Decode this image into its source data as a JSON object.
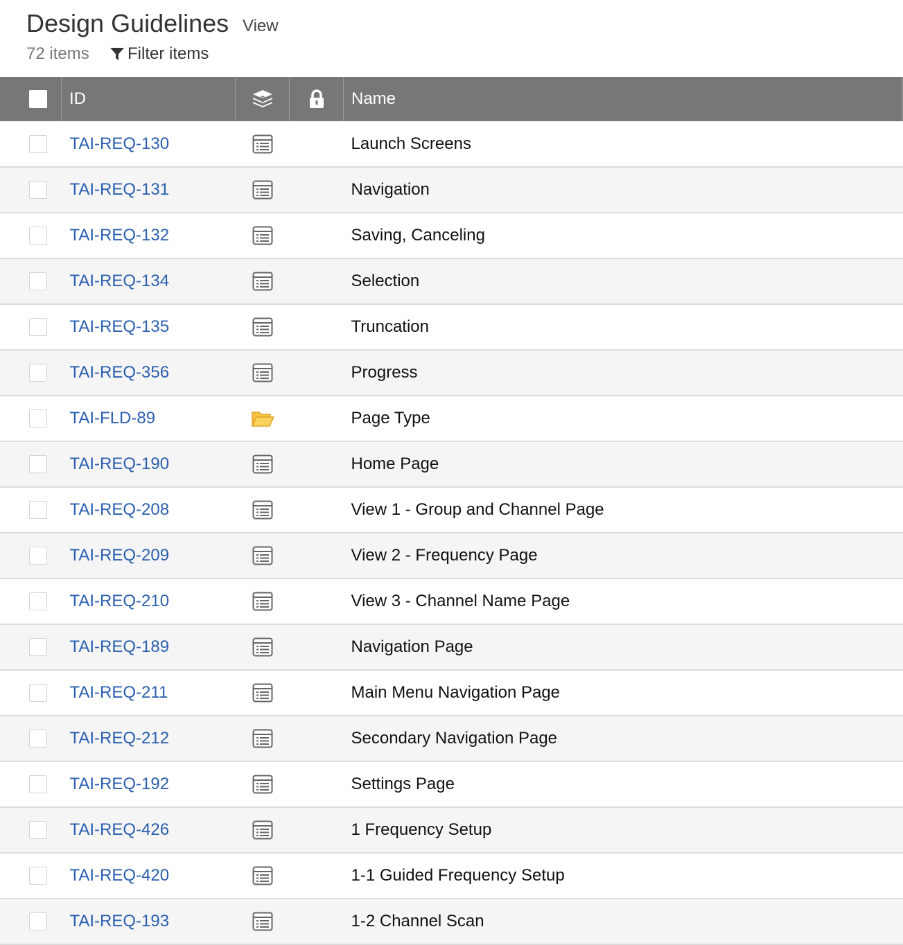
{
  "header": {
    "title": "Design Guidelines",
    "view_label": "View",
    "item_count": "72 items",
    "filter_label": "Filter items"
  },
  "table": {
    "columns": {
      "id": "ID",
      "type_icon": "stack-icon",
      "lock_icon": "lock-icon",
      "name": "Name"
    },
    "rows": [
      {
        "id": "TAI-REQ-130",
        "icon": "requirement-icon",
        "name": "Launch Screens"
      },
      {
        "id": "TAI-REQ-131",
        "icon": "requirement-icon",
        "name": "Navigation"
      },
      {
        "id": "TAI-REQ-132",
        "icon": "requirement-icon",
        "name": "Saving, Canceling"
      },
      {
        "id": "TAI-REQ-134",
        "icon": "requirement-icon",
        "name": "Selection"
      },
      {
        "id": "TAI-REQ-135",
        "icon": "requirement-icon",
        "name": "Truncation"
      },
      {
        "id": "TAI-REQ-356",
        "icon": "requirement-icon",
        "name": "Progress"
      },
      {
        "id": "TAI-FLD-89",
        "icon": "folder-icon",
        "name": "Page Type"
      },
      {
        "id": "TAI-REQ-190",
        "icon": "requirement-icon",
        "name": "Home Page"
      },
      {
        "id": "TAI-REQ-208",
        "icon": "requirement-icon",
        "name": "View 1 - Group and Channel Page"
      },
      {
        "id": "TAI-REQ-209",
        "icon": "requirement-icon",
        "name": "View 2 - Frequency Page"
      },
      {
        "id": "TAI-REQ-210",
        "icon": "requirement-icon",
        "name": "View 3 - Channel Name Page"
      },
      {
        "id": "TAI-REQ-189",
        "icon": "requirement-icon",
        "name": "Navigation Page"
      },
      {
        "id": "TAI-REQ-211",
        "icon": "requirement-icon",
        "name": "Main Menu Navigation Page"
      },
      {
        "id": "TAI-REQ-212",
        "icon": "requirement-icon",
        "name": "Secondary Navigation Page"
      },
      {
        "id": "TAI-REQ-192",
        "icon": "requirement-icon",
        "name": "Settings Page"
      },
      {
        "id": "TAI-REQ-426",
        "icon": "requirement-icon",
        "name": "1 Frequency Setup"
      },
      {
        "id": "TAI-REQ-420",
        "icon": "requirement-icon",
        "name": "1-1 Guided Frequency Setup"
      },
      {
        "id": "TAI-REQ-193",
        "icon": "requirement-icon",
        "name": "1-2 Channel Scan"
      }
    ]
  },
  "colors": {
    "header_bg": "#777777",
    "link": "#2a5fb0",
    "folder": "#f5c242",
    "stripe": "#f5f5f5"
  }
}
